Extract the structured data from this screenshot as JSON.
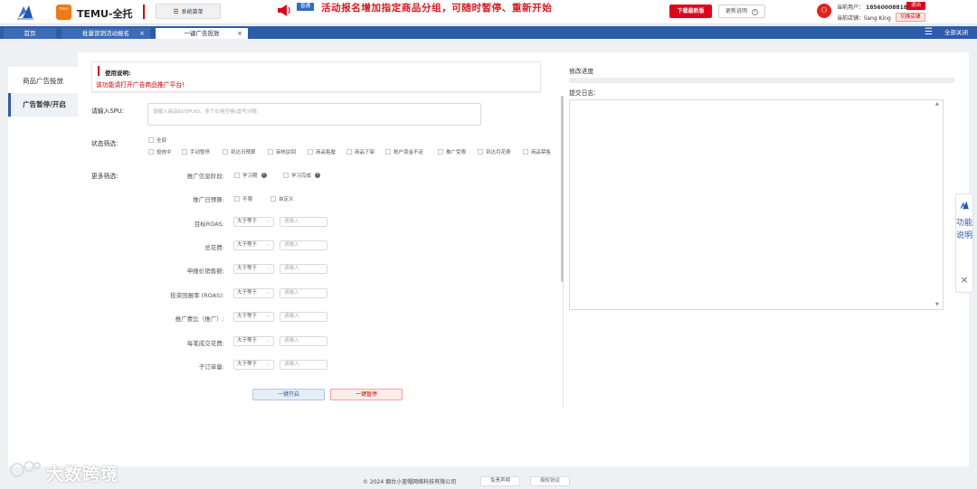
{
  "header": {
    "app_name": "TEMU-全托",
    "temu_logo_text": "TEMU",
    "system_menu": "系统菜单",
    "announcement_badge": "普通",
    "announcement": "活动报名增加指定商品分组，可随时暂停、重新开始",
    "download_button": "下载最新版",
    "update_button": "更新说明",
    "current_user_label": "当前用户：",
    "current_user": "18560008818",
    "logout_button": "退出",
    "current_shop_label": "当前店铺：",
    "current_shop": "liang King",
    "switch_shop_button": "切换店铺"
  },
  "tabs": [
    {
      "label": "首页",
      "closable": false,
      "active": false
    },
    {
      "label": "批量营销活动报名",
      "closable": true,
      "active": false
    },
    {
      "label": "一键广告投放",
      "closable": true,
      "active": true
    }
  ],
  "close_all": "全部关闭",
  "sidebar": {
    "items": [
      {
        "label": "商品广告投放",
        "active": false
      },
      {
        "label": "广告暂停/开启",
        "active": true
      }
    ]
  },
  "usage": {
    "title": "使用说明:",
    "text": "该功能请打开广告商品推广平台!"
  },
  "spu": {
    "label": "请输入SPU:",
    "placeholder": "请输入商品ID/SPUID，多个ID用空格/逗号分隔"
  },
  "status_filter": {
    "label": "状态筛选:",
    "all": "全部",
    "options": [
      "投放中",
      "手动暂停",
      "到达日预算",
      "审核驳回",
      "商品售罄",
      "商品下架",
      "账户资金不足",
      "推广受限",
      "到达月花费",
      "商品禁售"
    ]
  },
  "more_filter": {
    "label": "更多筛选:",
    "stage": {
      "label": "推广信息阶段:",
      "options": [
        "学习期",
        "学习完成"
      ]
    },
    "budget": {
      "label": "推广日预算:",
      "options": [
        "不限",
        "自定义"
      ]
    },
    "rows": [
      {
        "label": "目标ROAS:",
        "operator": "大于等于",
        "placeholder": "请输入"
      },
      {
        "label": "总花费:",
        "operator": "大于等于",
        "placeholder": "请输入"
      },
      {
        "label": "申报价销售额:",
        "operator": "大于等于",
        "placeholder": "请输入"
      },
      {
        "label": "投资回报率 (ROAS):",
        "operator": "大于等于",
        "placeholder": "请输入"
      },
      {
        "label": "推广费比（推广）:",
        "operator": "大于等于",
        "placeholder": "请输入"
      },
      {
        "label": "每笔成交花费:",
        "operator": "大于等于",
        "placeholder": "请输入"
      },
      {
        "label": "子订单量:",
        "operator": "大于等于",
        "placeholder": "请输入"
      }
    ]
  },
  "actions": {
    "start": "一键开启",
    "pause": "一键暂停"
  },
  "progress": {
    "label": "修改进度",
    "value": 0
  },
  "log": {
    "label": "提交日志:"
  },
  "side_widget": {
    "label": "功能说明"
  },
  "footer": {
    "copyright": "© 2024 烟台小蓝帽网络科技有限公司",
    "disclaimer": "免责声明",
    "license": "授权协议"
  },
  "watermark": "大数跨境",
  "colors": {
    "brand_blue": "#2d5cab",
    "accent_red": "#d40000",
    "temu_orange": "#f07a16"
  }
}
